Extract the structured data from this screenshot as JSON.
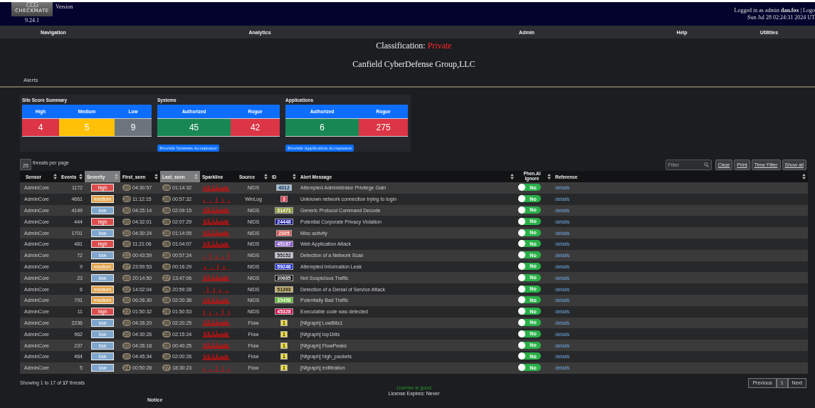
{
  "header": {
    "logo_top": "CCG",
    "logo_bottom": "CHECKMATE",
    "version_label": "Version",
    "version": "9.24.1",
    "user_line": "Logged in as admin **dan.fox** | Logo",
    "date_line": "Sun Jul 28 02:24:31 2024 UT"
  },
  "nav": [
    "Navigation",
    "Analytics",
    "Admin",
    "Help",
    "Utilities"
  ],
  "classification": {
    "label": "Classification:",
    "value": "Private"
  },
  "company": "Canfield CyberDefense Group,LLC",
  "section_title": "Alerts",
  "summary": {
    "site_title": "Site Score Summary",
    "site": [
      {
        "label": "High",
        "value": "4",
        "color": "#dc3545"
      },
      {
        "label": "Medium",
        "value": "5",
        "color": "#ffc107"
      },
      {
        "label": "Low",
        "value": "9",
        "color": "#6c757d"
      }
    ],
    "systems_title": "Systems",
    "systems": [
      {
        "label": "Authorized",
        "value": "45",
        "color": "#198754"
      },
      {
        "label": "Rogue",
        "value": "42",
        "color": "#dc3545"
      }
    ],
    "systems_button": "Provide Systems Acceptance",
    "apps_title": "Applications",
    "apps": [
      {
        "label": "Authorized",
        "value": "6",
        "color": "#198754"
      },
      {
        "label": "Rogue",
        "value": "275",
        "color": "#dc3545"
      }
    ],
    "apps_button": "Provide Application Acceptance"
  },
  "per_page": {
    "value": "25",
    "label": "threats per page"
  },
  "search": {
    "placeholder": "Filter"
  },
  "toolbar_buttons": [
    "Clear",
    "Print",
    "Time Filter",
    "Show all"
  ],
  "table": {
    "columns": [
      {
        "label": "Sensor",
        "sortable": true,
        "sorted": false
      },
      {
        "label": "Events",
        "sortable": true,
        "sorted": false
      },
      {
        "label": "Severity",
        "sortable": true,
        "sorted": true
      },
      {
        "label": "First_seen",
        "sortable": true,
        "sorted": false
      },
      {
        "label": "Last_seen",
        "sortable": true,
        "sorted": true
      },
      {
        "label": "Sparkline",
        "sortable": false,
        "sorted": false
      },
      {
        "label": "Source",
        "sortable": true,
        "sorted": false
      },
      {
        "label": "ID",
        "sortable": true,
        "sorted": false
      },
      {
        "label": "Alert Message",
        "sortable": true,
        "sorted": false
      },
      {
        "label": "Phen.AI Ignore",
        "sortable": true,
        "sorted": false
      },
      {
        "label": "Reference",
        "sortable": true,
        "sorted": false
      }
    ],
    "rows": [
      {
        "sensor": "AdminCore",
        "events": "1172",
        "severity": {
          "text": "high",
          "color": "#dc4c4c"
        },
        "first_day": "20",
        "first": "04:30:57",
        "last_day": "28",
        "last": "01:14:32",
        "source": "NIDS",
        "id": {
          "text": "4312",
          "color": "#9ec5e8"
        },
        "message": "Attempted Administrator Privilege Gain",
        "ignore": {
          "label": "No",
          "on": false
        },
        "reference": "details"
      },
      {
        "sensor": "AdminCore",
        "events": "4661",
        "severity": {
          "text": "medium",
          "color": "#e0a24a"
        },
        "first_day": "20",
        "first": "11:12:15",
        "last_day": "28",
        "last": "00:57:32",
        "source": "WinLog",
        "id": {
          "text": "3",
          "color": "#e0324a"
        },
        "message": "Unknown network connection trying to login",
        "ignore": {
          "label": "No",
          "on": false
        },
        "reference": "details"
      },
      {
        "sensor": "AdminCore",
        "events": "4149",
        "severity": {
          "text": "low",
          "color": "#7fa6cc"
        },
        "first_day": "20",
        "first": "04:25:14",
        "last_day": "28",
        "last": "02:09:15",
        "source": "NIDS",
        "id": {
          "text": "31471",
          "color": "#8f9a3a"
        },
        "message": "Generic Protocol Command Decode",
        "ignore": {
          "label": "No",
          "on": false
        },
        "reference": "details"
      },
      {
        "sensor": "AdminCore",
        "events": "444",
        "severity": {
          "text": "high",
          "color": "#dc4c4c"
        },
        "first_day": "20",
        "first": "04:32:01",
        "last_day": "28",
        "last": "02:07:29",
        "source": "NIDS",
        "id": {
          "text": "24448",
          "color": "#1a1a9a"
        },
        "message": "Potential Corporate Privacy Violation",
        "ignore": {
          "label": "No",
          "on": false
        },
        "reference": "details"
      },
      {
        "sensor": "AdminCore",
        "events": "1701",
        "severity": {
          "text": "low",
          "color": "#7fa6cc"
        },
        "first_day": "20",
        "first": "04:30:24",
        "last_day": "28",
        "last": "01:14:05",
        "source": "NIDS",
        "id": {
          "text": "2305",
          "color": "#d9534f"
        },
        "message": "Misc activity",
        "ignore": {
          "label": "No",
          "on": false
        },
        "reference": "details"
      },
      {
        "sensor": "AdminCore",
        "events": "481",
        "severity": {
          "text": "high",
          "color": "#dc4c4c"
        },
        "first_day": "20",
        "first": "11:21:06",
        "last_day": "28",
        "last": "01:04:07",
        "source": "NIDS",
        "id": {
          "text": "45187",
          "color": "#8a5ad0"
        },
        "message": "Web Application Attack",
        "ignore": {
          "label": "No",
          "on": false
        },
        "reference": "details"
      },
      {
        "sensor": "AdminCore",
        "events": "72",
        "severity": {
          "text": "low",
          "color": "#7fa6cc"
        },
        "first_day": "21",
        "first": "00:43:59",
        "last_day": "28",
        "last": "00:57:24",
        "source": "NIDS",
        "id": {
          "text": "55152",
          "color": "#c8c8d8"
        },
        "message": "Detection of a Network Scan",
        "ignore": {
          "label": "No",
          "on": false
        },
        "reference": "details"
      },
      {
        "sensor": "AdminCore",
        "events": "9",
        "severity": {
          "text": "medium",
          "color": "#e0a24a"
        },
        "first_day": "27",
        "first": "23:59:53",
        "last_day": "28",
        "last": "00:16:29",
        "source": "NIDS",
        "id": {
          "text": "59246",
          "color": "#2236d8"
        },
        "message": "Attempted Information Leak",
        "ignore": {
          "label": "No",
          "on": false
        },
        "reference": "details"
      },
      {
        "sensor": "AdminCore",
        "events": "23",
        "severity": {
          "text": "low",
          "color": "#7fa6cc"
        },
        "first_day": "20",
        "first": "20:14:50",
        "last_day": "27",
        "last": "13:47:06",
        "source": "NIDS",
        "id": {
          "text": "30685",
          "color": "#101010"
        },
        "message": "Not Suspicious Traffic",
        "ignore": {
          "label": "No",
          "on": false
        },
        "reference": "details"
      },
      {
        "sensor": "AdminCore",
        "events": "6",
        "severity": {
          "text": "medium",
          "color": "#e0a24a"
        },
        "first_day": "22",
        "first": "14:02:04",
        "last_day": "25",
        "last": "20:59:28",
        "source": "NIDS",
        "id": {
          "text": "51393",
          "color": "#c9b46a"
        },
        "message": "Detection of a Denial of Service Attack",
        "ignore": {
          "label": "No",
          "on": false
        },
        "reference": "details"
      },
      {
        "sensor": "AdminCore",
        "events": "791",
        "severity": {
          "text": "medium",
          "color": "#e0a24a"
        },
        "first_day": "20",
        "first": "06:26:30",
        "last_day": "28",
        "last": "02:20:38",
        "source": "NIDS",
        "id": {
          "text": "35458",
          "color": "#5cb82a"
        },
        "message": "Potentially Bad Traffic",
        "ignore": {
          "label": "No",
          "on": false
        },
        "reference": "details"
      },
      {
        "sensor": "AdminCore",
        "events": "11",
        "severity": {
          "text": "high",
          "color": "#dc4c4c"
        },
        "first_day": "23",
        "first": "01:50:32",
        "last_day": "28",
        "last": "01:50:53",
        "source": "NIDS",
        "id": {
          "text": "45328",
          "color": "#d0134a"
        },
        "message": "Executable code was detected",
        "ignore": {
          "label": "No",
          "on": false
        },
        "reference": "details"
      },
      {
        "sensor": "AdminCore",
        "events": "2236",
        "severity": {
          "text": "low",
          "color": "#7fa6cc"
        },
        "first_day": "20",
        "first": "04:26:20",
        "last_day": "28",
        "last": "02:20:25",
        "source": "Flow",
        "id": {
          "text": "1",
          "color": "#f0e040"
        },
        "message": "[Nfgraph] LowBits1",
        "ignore": {
          "label": "No",
          "on": false
        },
        "reference": "details"
      },
      {
        "sensor": "AdminCore",
        "events": "962",
        "severity": {
          "text": "low",
          "color": "#7fa6cc"
        },
        "first_day": "20",
        "first": "04:30:26",
        "last_day": "28",
        "last": "02:15:24",
        "source": "Flow",
        "id": {
          "text": "1",
          "color": "#f0e040"
        },
        "message": "[Nfgraph] top1bits",
        "ignore": {
          "label": "No",
          "on": false
        },
        "reference": "details"
      },
      {
        "sensor": "AdminCore",
        "events": "237",
        "severity": {
          "text": "low",
          "color": "#7fa6cc"
        },
        "first_day": "20",
        "first": "04:26:18",
        "last_day": "28",
        "last": "00:40:25",
        "source": "Flow",
        "id": {
          "text": "1",
          "color": "#f0e040"
        },
        "message": "[Nfgraph] FlowPeaks",
        "ignore": {
          "label": "No",
          "on": false
        },
        "reference": "details"
      },
      {
        "sensor": "AdminCore",
        "events": "464",
        "severity": {
          "text": "low",
          "color": "#7fa6cc"
        },
        "first_day": "20",
        "first": "04:45:34",
        "last_day": "28",
        "last": "02:00:26",
        "source": "Flow",
        "id": {
          "text": "1",
          "color": "#f0e040"
        },
        "message": "[Nfgraph] high_packets",
        "ignore": {
          "label": "No",
          "on": false
        },
        "reference": "details"
      },
      {
        "sensor": "AdminCore",
        "events": "5",
        "severity": {
          "text": "low",
          "color": "#7fa6cc"
        },
        "first_day": "24",
        "first": "00:50:28",
        "last_day": "27",
        "last": "18:30:23",
        "source": "Flow",
        "id": {
          "text": "1",
          "color": "#f0e040"
        },
        "message": "[Nfgraph] exfiltration",
        "ignore": {
          "label": "No",
          "on": false
        },
        "reference": "details"
      }
    ]
  },
  "showing": "Showing 1 to 17 of **17** threats",
  "pagination": [
    {
      "label": "Previous",
      "selected": false
    },
    {
      "label": "1",
      "selected": true
    },
    {
      "label": "Next",
      "selected": false
    }
  ],
  "license_status": "License is good",
  "license_expiry": "License Expires: Never",
  "notice": "Notice"
}
